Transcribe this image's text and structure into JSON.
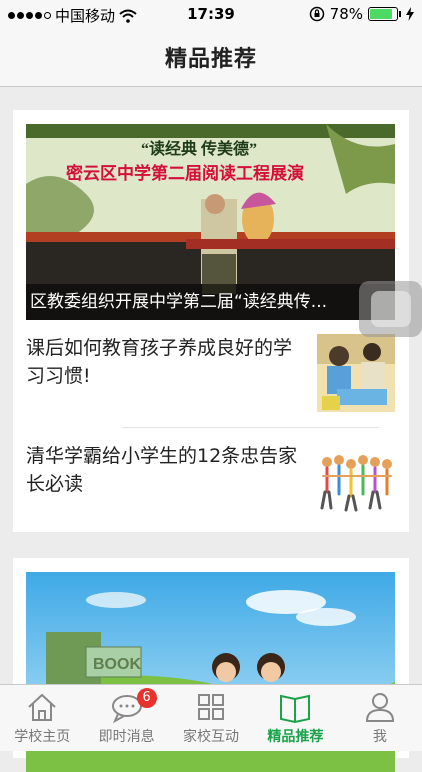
{
  "status_bar": {
    "carrier": "中国移动",
    "time": "17:39",
    "battery_percent": "78%",
    "battery_level": 0.78,
    "signal_bars": 4
  },
  "navbar": {
    "title": "精品推荐"
  },
  "featured": {
    "headline": "区教委组织开展中学第二届“读经典传..."
  },
  "articles": [
    {
      "title": "课后如何教育孩子养成良好的学习习惯!"
    },
    {
      "title": "清华学霸给小学生的12条忠告家长必读"
    }
  ],
  "tabs": [
    {
      "label": "学校主页",
      "icon": "home-icon"
    },
    {
      "label": "即时消息",
      "icon": "chat-icon",
      "badge": "6"
    },
    {
      "label": "家校互动",
      "icon": "grid-icon"
    },
    {
      "label": "精品推荐",
      "icon": "book-icon",
      "active": true
    },
    {
      "label": "我",
      "icon": "person-icon"
    }
  ],
  "colors": {
    "accent": "#1aa34a",
    "badge": "#e8322e",
    "battery": "#4cd964"
  }
}
